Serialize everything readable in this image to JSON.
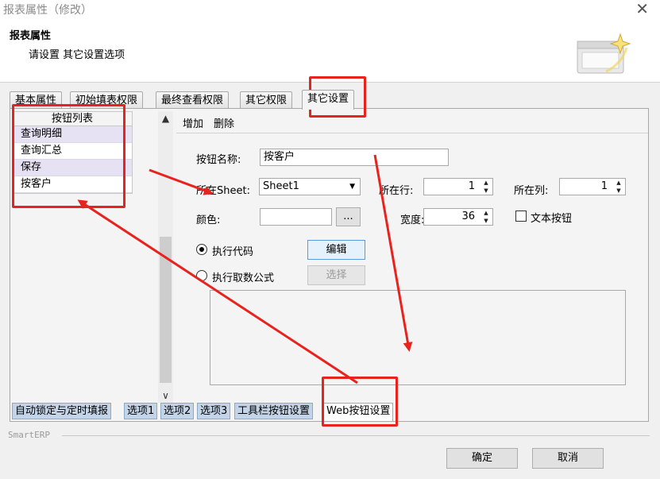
{
  "window": {
    "title": "报表属性（修改）",
    "close_glyph": "✕"
  },
  "header": {
    "title": "报表属性",
    "subtitle": "请设置 其它设置选项"
  },
  "outer_tabs": [
    {
      "label": "基本属性",
      "active": false
    },
    {
      "label": "初始填表权限",
      "active": false
    },
    {
      "label": "最终查看权限",
      "active": false
    },
    {
      "label": "其它权限",
      "active": false
    },
    {
      "label": "其它设置",
      "active": true
    }
  ],
  "button_list": {
    "header": "按钮列表",
    "items": [
      {
        "label": "查询明细",
        "selected": true
      },
      {
        "label": "查询汇总",
        "selected": false
      },
      {
        "label": "保存",
        "selected": true
      },
      {
        "label": "按客户",
        "selected": false
      }
    ]
  },
  "scrollbar": {
    "up": "▲",
    "down": "∨"
  },
  "toolbar": {
    "add": "增加",
    "delete": "删除"
  },
  "form": {
    "button_name_label": "按钮名称:",
    "button_name_value": "按客户",
    "sheet_label": "所在Sheet:",
    "sheet_value": "Sheet1",
    "row_label": "所在行:",
    "row_value": "1",
    "col_label": "所在列:",
    "col_value": "1",
    "color_label": "颜色:",
    "color_value": "",
    "color_button": "...",
    "width_label": "宽度:",
    "width_value": "36",
    "text_button_label": "文本按钮",
    "exec_code_label": "执行代码",
    "edit_button": "编辑",
    "exec_formula_label": "执行取数公式",
    "select_button": "选择"
  },
  "bottom_tabs": [
    {
      "label": "自动锁定与定时填报",
      "active": false
    },
    {
      "label": "选项1",
      "active": false
    },
    {
      "label": "选项2",
      "active": false
    },
    {
      "label": "选项3",
      "active": false
    },
    {
      "label": "工具栏按钮设置",
      "active": false
    },
    {
      "label": "Web按钮设置",
      "active": true
    }
  ],
  "footer": {
    "brand": "SmartERP",
    "ok": "确定",
    "cancel": "取消"
  },
  "annotation_color": "#e8231e"
}
